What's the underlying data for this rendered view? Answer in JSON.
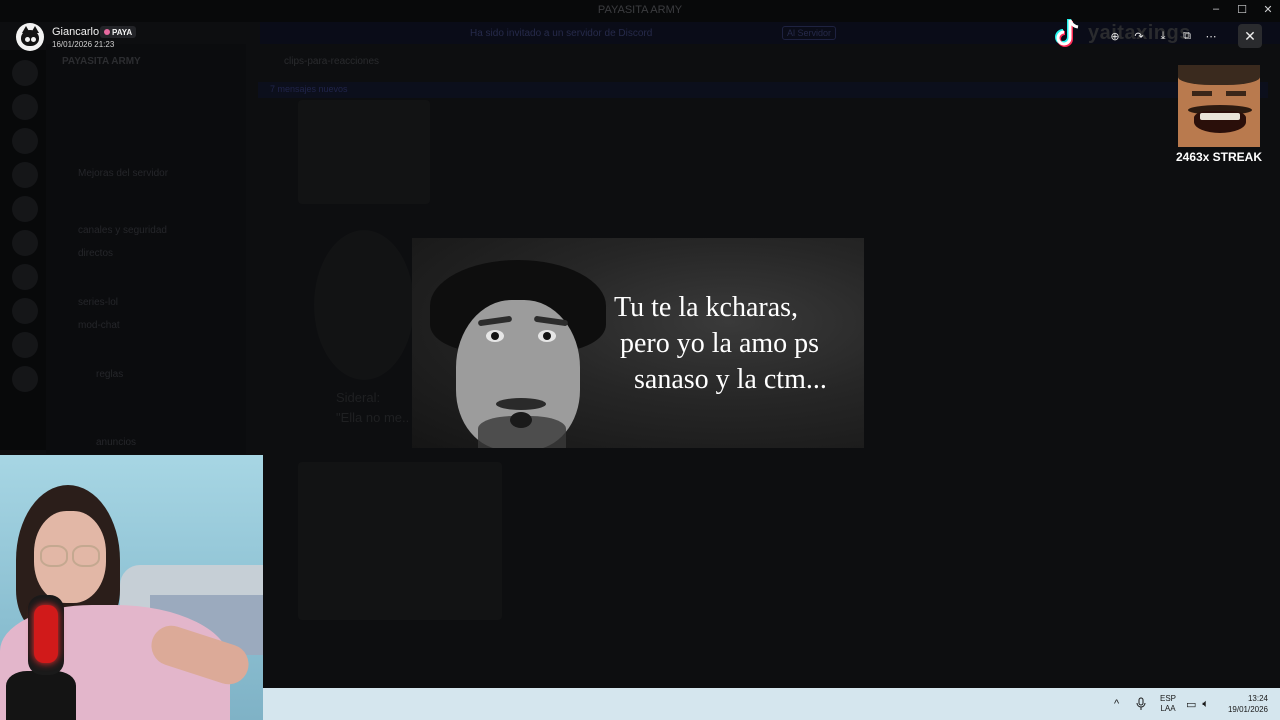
{
  "app": {
    "window_title": "PAYASITA ARMY",
    "server_name": "PAYASITA ARMY",
    "channel_header": "clips-para-reacciones",
    "banner_text": "Ha sido invitado a un servidor de Discord",
    "banner_button": "Al Servidor",
    "new_messages": "7 mensajes nuevos",
    "channels": [
      {
        "label": "Mejoras del servidor"
      },
      {
        "label": "canales y seguridad"
      },
      {
        "label": "directos"
      },
      {
        "label": "series-lol"
      },
      {
        "label": "mod-chat"
      },
      {
        "label": "reglas"
      },
      {
        "label": "anuncios"
      }
    ],
    "background_message": "Sideral:",
    "background_quote": "\"Ella no me... estaba con..."
  },
  "viewer": {
    "username": "Giancarlo",
    "role_badge": "PAYA",
    "date": "16/01/2026 21:23",
    "tools": [
      {
        "icon": "zoom-in-icon",
        "glyph": "⊕"
      },
      {
        "icon": "forward-icon",
        "glyph": "↷"
      },
      {
        "icon": "download-icon",
        "glyph": "⤓"
      },
      {
        "icon": "open-external-icon",
        "glyph": "⧉"
      },
      {
        "icon": "more-icon",
        "glyph": "⋯"
      }
    ],
    "close_glyph": "✕",
    "watermark": "yaitaxings"
  },
  "image": {
    "quote_lines": [
      "Tu te la kcharas,",
      "pero yo la amo ps",
      "sanaso y la ctm..."
    ]
  },
  "overlay": {
    "streak_text": "2463x STREAK"
  },
  "taskbar": {
    "chevron": "^",
    "lang_top": "ESP",
    "lang_bottom": "LAA",
    "time": "13:24",
    "date": "19/01/2026"
  },
  "colors": {
    "accent_pink": "#e86aa0",
    "mic_red": "#d11a1a",
    "taskbar": "#d5e6ee"
  }
}
